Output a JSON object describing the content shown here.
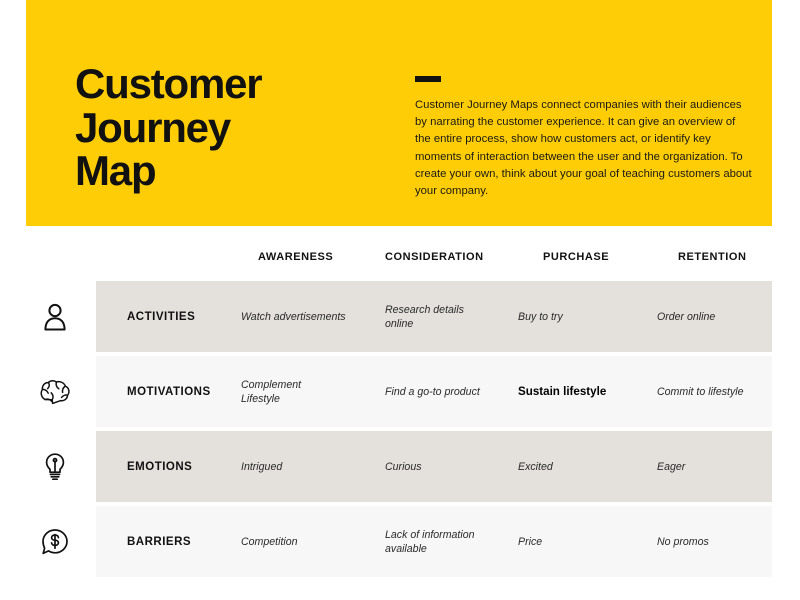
{
  "hero": {
    "title": "Customer\nJourney\nMap",
    "description": "Customer Journey Maps connect companies with their audiences by narrating the customer experience. It can give an overview of the entire process, show how customers act, or identify key moments of interaction between the user and the organization. To create your own, think about your goal of teaching customers about your company.",
    "background_color": "#FFCD05",
    "text_color": "#111111"
  },
  "matrix": {
    "column_headers": [
      "AWARENESS",
      "CONSIDERATION",
      "PURCHASE",
      "RETENTION"
    ],
    "row_shade_dark": "#E4E0DC",
    "row_shade_light": "#F7F7F7",
    "rows": [
      {
        "label": "ACTIVITIES",
        "icon": "person-icon",
        "shade": "dark",
        "cells": [
          "Watch advertisements",
          "Research details online",
          "Buy to try",
          "Order online"
        ],
        "highlight_index": -1
      },
      {
        "label": "MOTIVATIONS",
        "icon": "brain-icon",
        "shade": "light",
        "cells": [
          "Complement Lifestyle",
          "Find a go-to product",
          "Sustain lifestyle",
          "Commit to lifestyle"
        ],
        "highlight_index": 2
      },
      {
        "label": "EMOTIONS",
        "icon": "lightbulb-icon",
        "shade": "dark",
        "cells": [
          "Intrigued",
          "Curious",
          "Excited",
          "Eager"
        ],
        "highlight_index": -1
      },
      {
        "label": "BARRIERS",
        "icon": "dollar-speech-bubble-icon",
        "shade": "light",
        "cells": [
          "Competition",
          "Lack of information available",
          "Price",
          "No promos"
        ],
        "highlight_index": -1
      }
    ]
  }
}
